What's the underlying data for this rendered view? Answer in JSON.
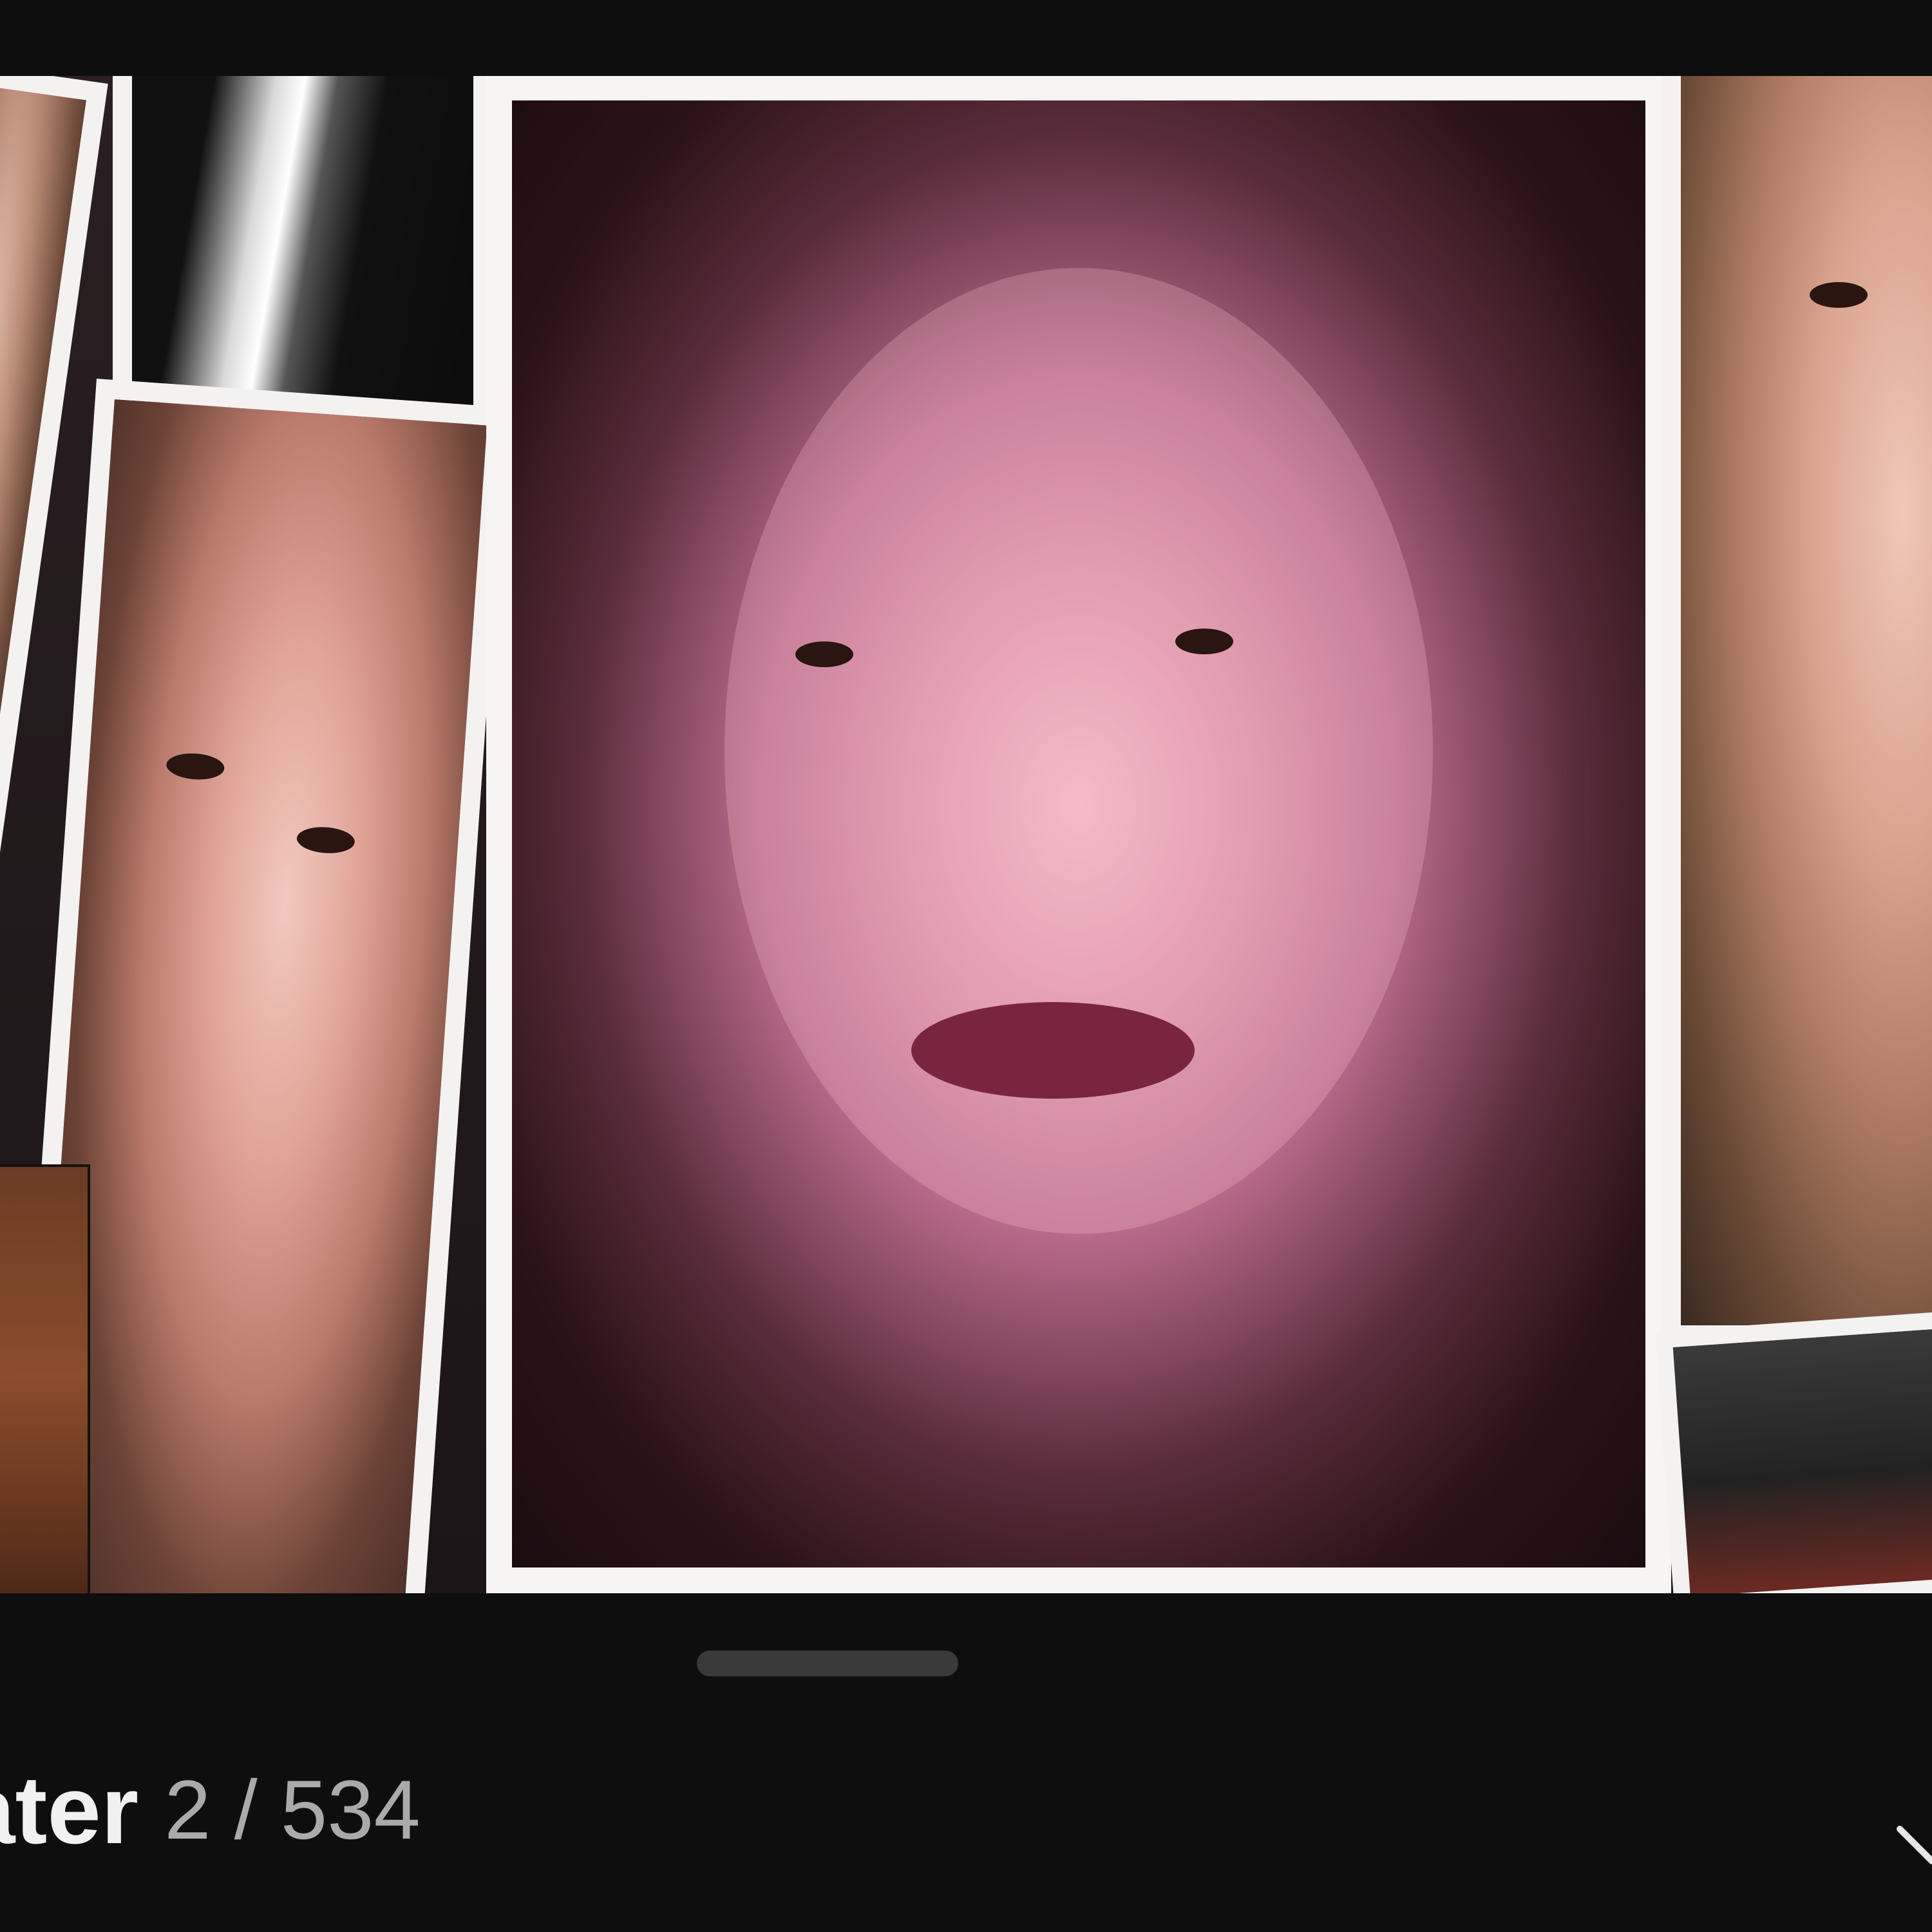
{
  "playlist": {
    "title_fragment": "ater",
    "current_index": "2",
    "separator": "/",
    "total_count": "534"
  },
  "icons": {
    "expand": "chevron-down-icon"
  },
  "colors": {
    "background": "#0e0e0e",
    "title_text": "#f1f1f1",
    "counter_text": "#aaaaaa",
    "photo_border": "#f4f2f0",
    "drag_handle": "#3a3a3a"
  }
}
